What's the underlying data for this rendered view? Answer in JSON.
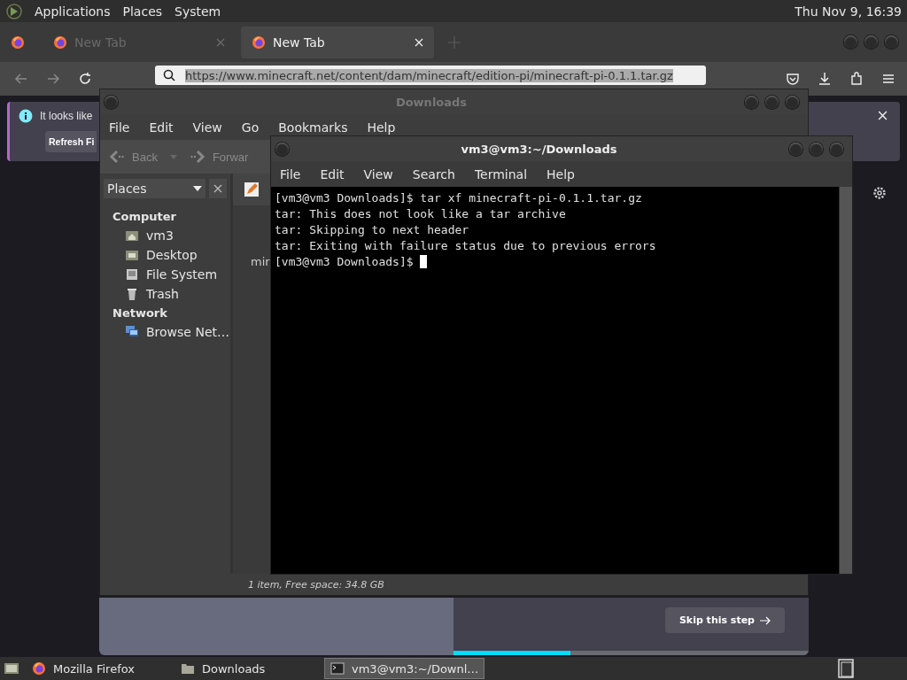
{
  "top_panel": {
    "menus": [
      "Applications",
      "Places",
      "System"
    ],
    "clock": "Thu Nov  9, 16:39"
  },
  "browser": {
    "tabs": [
      {
        "label": "New Tab",
        "selected": false
      },
      {
        "label": "New Tab",
        "selected": true
      }
    ],
    "url": "https://www.minecraft.net/content/dam/minecraft/edition-pi/minecraft-pi-0.1.1.tar.gz",
    "notification": {
      "text": "It looks like",
      "button": "Refresh Fi"
    },
    "onboarding": {
      "skip_button": "Skip this step",
      "progress": {
        "level": 0.33
      }
    }
  },
  "file_manager": {
    "title": "Downloads",
    "menus": [
      "File",
      "Edit",
      "View",
      "Go",
      "Bookmarks",
      "Help"
    ],
    "toolbar": [
      {
        "kind": "back",
        "label": "Back"
      },
      {
        "kind": "forward",
        "label": "Forwar"
      }
    ],
    "sidebar": {
      "selector": "Places",
      "sections": [
        {
          "heading": "Computer",
          "items": [
            {
              "kind": "home",
              "label": "vm3"
            },
            {
              "kind": "desktop",
              "label": "Desktop"
            },
            {
              "kind": "drive",
              "label": "File System"
            },
            {
              "kind": "trash",
              "label": "Trash"
            }
          ]
        },
        {
          "heading": "Network",
          "items": [
            {
              "kind": "network",
              "label": "Browse Net…"
            }
          ]
        }
      ]
    },
    "file_label": "mir",
    "status": "1 item, Free space: 34.8 GB"
  },
  "terminal": {
    "title": "vm3@vm3:~/Downloads",
    "menus": [
      "File",
      "Edit",
      "View",
      "Search",
      "Terminal",
      "Help"
    ],
    "lines": [
      "[vm3@vm3 Downloads]$ tar xf minecraft-pi-0.1.1.tar.gz",
      "tar: This does not look like a tar archive",
      "tar: Skipping to next header",
      "tar: Exiting with failure status due to previous errors"
    ],
    "prompt": "[vm3@vm3 Downloads]$ "
  },
  "taskbar": {
    "items": [
      {
        "kind": "browser",
        "label": "Mozilla Firefox",
        "selected": false
      },
      {
        "kind": "folder",
        "label": "Downloads",
        "selected": false
      },
      {
        "kind": "terminal",
        "label": "vm3@vm3:~/Downl…",
        "selected": true
      }
    ]
  }
}
